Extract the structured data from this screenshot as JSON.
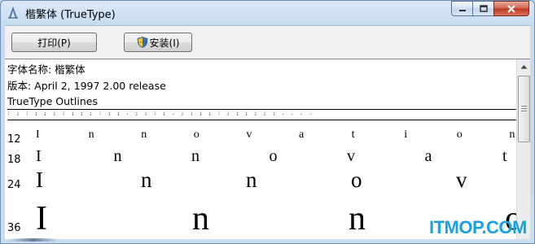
{
  "window": {
    "title": "楷繁体 (TrueType)",
    "icon": "font-file-icon",
    "controls": {
      "minimize_icon": "minimize-icon",
      "maximize_icon": "maximize-icon",
      "close_icon": "close-icon"
    }
  },
  "toolbar": {
    "print_label": "打印(P)",
    "install_label": "安装(I)",
    "install_icon": "uac-shield-icon"
  },
  "info": {
    "font_name": "字体名称: 楷繁体",
    "version": "版本: April 2, 1997 2.00 release",
    "type": "TrueType Outlines"
  },
  "samples": [
    {
      "size": "12",
      "glyphs": [
        "I",
        "n",
        "n",
        "o",
        "v",
        "a",
        "t",
        "i",
        "o",
        "n"
      ]
    },
    {
      "size": "18",
      "glyphs": [
        "I",
        "n",
        "n",
        "o",
        "v",
        "a",
        "t"
      ]
    },
    {
      "size": "24",
      "glyphs": [
        "I",
        "n",
        "n",
        "o",
        "v"
      ]
    },
    {
      "size": "36",
      "glyphs": [
        "I",
        "n",
        "n",
        "o"
      ]
    }
  ],
  "watermark": "ITMOP.COM",
  "colors": {
    "titlebar": "#c9ddf1",
    "close_button": "#c0391f",
    "watermark": "#17a3df"
  }
}
